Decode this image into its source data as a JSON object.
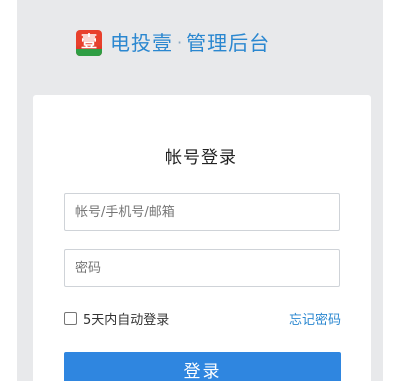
{
  "brand": {
    "logo_glyph": "壹",
    "name": "电投壹",
    "separator": "·",
    "subtitle": "管理后台"
  },
  "login": {
    "title": "帐号登录",
    "account_placeholder": "帐号/手机号/邮箱",
    "password_placeholder": "密码",
    "remember_label": "5天内自动登录",
    "forgot_label": "忘记密码",
    "submit_label": "登录"
  },
  "colors": {
    "accent": "#2a87d0",
    "button": "#2f86e0",
    "panel_bg": "#e8e9eb",
    "logo_red": "#e8402c",
    "logo_green": "#2f9e44"
  }
}
